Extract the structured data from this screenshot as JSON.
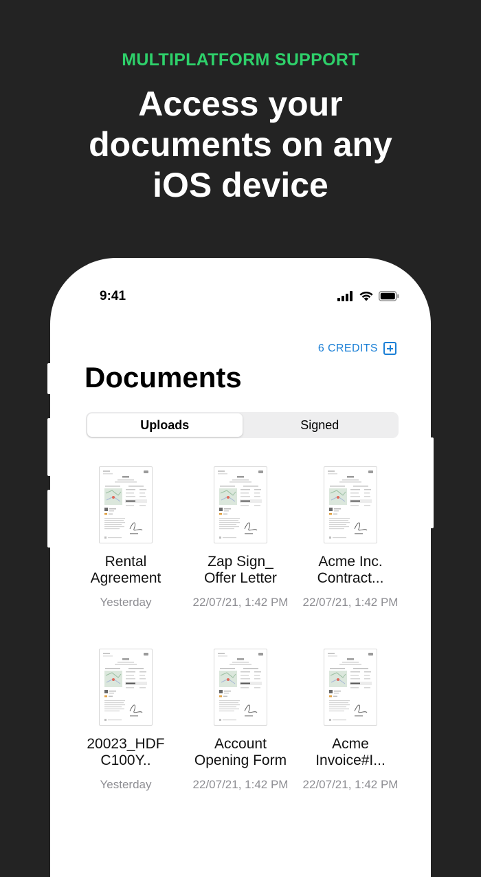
{
  "hero": {
    "tagline": "MULTIPLATFORM SUPPORT",
    "headline_lines": [
      "Access your",
      "documents on any",
      "iOS device"
    ]
  },
  "status_bar": {
    "time": "9:41",
    "icons": [
      "cellular-signal-icon",
      "wifi-icon",
      "battery-icon"
    ]
  },
  "credits": {
    "label": "6 CREDITS",
    "icon": "plus-square-icon"
  },
  "page": {
    "title": "Documents"
  },
  "segmented_control": {
    "options": [
      "Uploads",
      "Signed"
    ],
    "selected": "Uploads"
  },
  "documents": [
    {
      "name_lines": [
        "Rental",
        "Agreement"
      ],
      "date": "Yesterday"
    },
    {
      "name_lines": [
        "Zap Sign_",
        "Offer Letter"
      ],
      "date": "22/07/21, 1:42 PM"
    },
    {
      "name_lines": [
        "Acme Inc.",
        "Contract..."
      ],
      "date": "22/07/21, 1:42 PM"
    },
    {
      "name_lines": [
        "20023_HDF",
        "C100Y.."
      ],
      "date": "Yesterday"
    },
    {
      "name_lines": [
        "Account",
        "Opening Form"
      ],
      "date": "22/07/21, 1:42 PM"
    },
    {
      "name_lines": [
        "Acme",
        "Invoice#I..."
      ],
      "date": "22/07/21, 1:42 PM"
    }
  ],
  "colors": {
    "background": "#232323",
    "accent_green": "#2ed06a",
    "link_blue": "#1a7fd6",
    "secondary_text": "#8e8e93"
  }
}
